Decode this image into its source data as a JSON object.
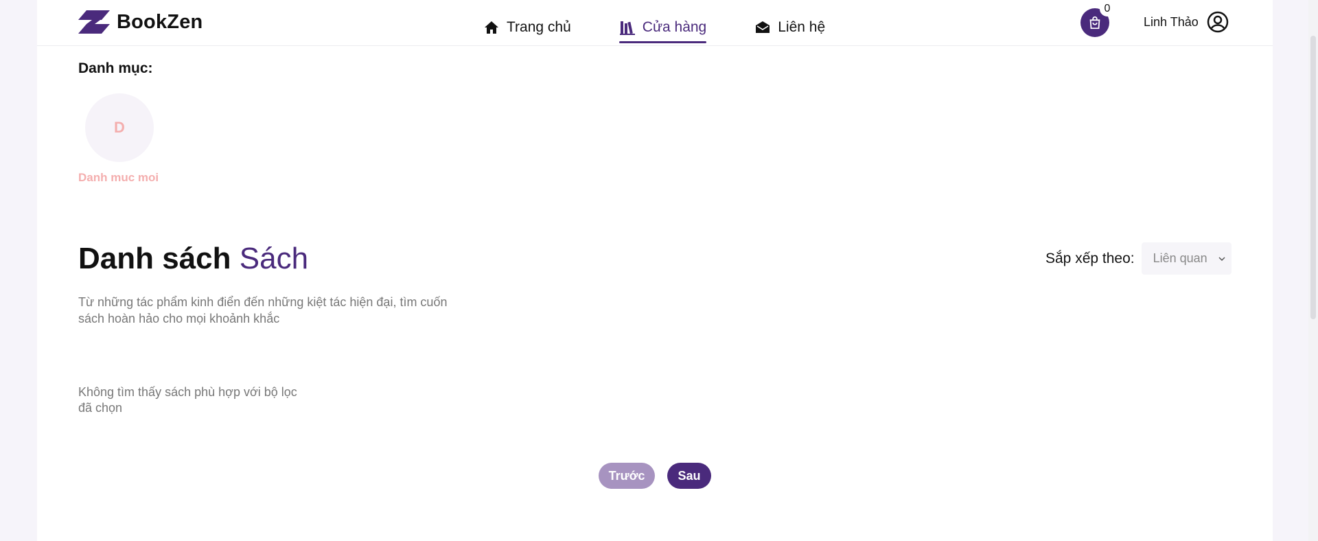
{
  "header": {
    "brand": "BookZen",
    "nav": [
      {
        "label": "Trang chủ",
        "icon": "home-icon",
        "active": false
      },
      {
        "label": "Cửa hàng",
        "icon": "books-icon",
        "active": true
      },
      {
        "label": "Liên hệ",
        "icon": "envelope-icon",
        "active": false
      }
    ],
    "cart_count": "0",
    "user_name": "Linh Thảo"
  },
  "categories": {
    "title": "Danh mục:",
    "items": [
      {
        "initial": "D",
        "label": "Danh muc moi"
      }
    ]
  },
  "book_list": {
    "title_main": "Danh sách",
    "title_accent": "Sách",
    "description": "Từ những tác phẩm kinh điển đến những kiệt tác hiện đại, tìm cuốn sách hoàn hảo cho mọi khoảnh khắc",
    "sort_label": "Sắp xếp theo:",
    "sort_value": "Liên quan",
    "empty_message": "Không tìm thấy sách phù hợp với bộ lọc đã chọn"
  },
  "pagination": {
    "prev_label": "Trước",
    "next_label": "Sau"
  },
  "colors": {
    "brand": "#4a2a7c",
    "brand_light": "#a793c0",
    "category_text": "#f4aeae"
  }
}
